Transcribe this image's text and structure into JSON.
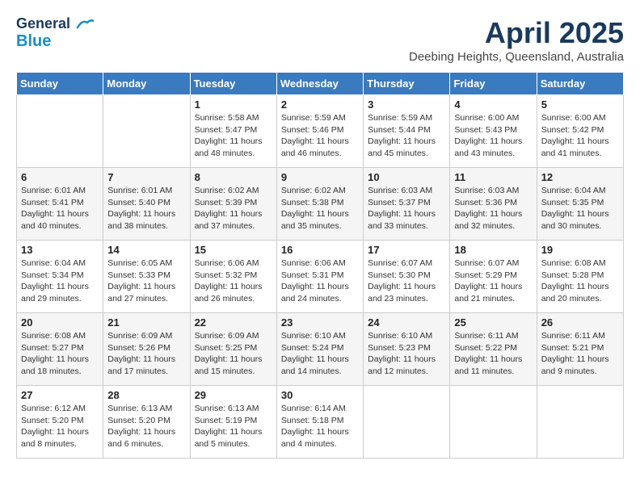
{
  "header": {
    "logo_line1": "General",
    "logo_line2": "Blue",
    "month": "April 2025",
    "location": "Deebing Heights, Queensland, Australia"
  },
  "weekdays": [
    "Sunday",
    "Monday",
    "Tuesday",
    "Wednesday",
    "Thursday",
    "Friday",
    "Saturday"
  ],
  "weeks": [
    [
      {
        "day": "",
        "info": ""
      },
      {
        "day": "",
        "info": ""
      },
      {
        "day": "1",
        "info": "Sunrise: 5:58 AM\nSunset: 5:47 PM\nDaylight: 11 hours and 48 minutes."
      },
      {
        "day": "2",
        "info": "Sunrise: 5:59 AM\nSunset: 5:46 PM\nDaylight: 11 hours and 46 minutes."
      },
      {
        "day": "3",
        "info": "Sunrise: 5:59 AM\nSunset: 5:44 PM\nDaylight: 11 hours and 45 minutes."
      },
      {
        "day": "4",
        "info": "Sunrise: 6:00 AM\nSunset: 5:43 PM\nDaylight: 11 hours and 43 minutes."
      },
      {
        "day": "5",
        "info": "Sunrise: 6:00 AM\nSunset: 5:42 PM\nDaylight: 11 hours and 41 minutes."
      }
    ],
    [
      {
        "day": "6",
        "info": "Sunrise: 6:01 AM\nSunset: 5:41 PM\nDaylight: 11 hours and 40 minutes."
      },
      {
        "day": "7",
        "info": "Sunrise: 6:01 AM\nSunset: 5:40 PM\nDaylight: 11 hours and 38 minutes."
      },
      {
        "day": "8",
        "info": "Sunrise: 6:02 AM\nSunset: 5:39 PM\nDaylight: 11 hours and 37 minutes."
      },
      {
        "day": "9",
        "info": "Sunrise: 6:02 AM\nSunset: 5:38 PM\nDaylight: 11 hours and 35 minutes."
      },
      {
        "day": "10",
        "info": "Sunrise: 6:03 AM\nSunset: 5:37 PM\nDaylight: 11 hours and 33 minutes."
      },
      {
        "day": "11",
        "info": "Sunrise: 6:03 AM\nSunset: 5:36 PM\nDaylight: 11 hours and 32 minutes."
      },
      {
        "day": "12",
        "info": "Sunrise: 6:04 AM\nSunset: 5:35 PM\nDaylight: 11 hours and 30 minutes."
      }
    ],
    [
      {
        "day": "13",
        "info": "Sunrise: 6:04 AM\nSunset: 5:34 PM\nDaylight: 11 hours and 29 minutes."
      },
      {
        "day": "14",
        "info": "Sunrise: 6:05 AM\nSunset: 5:33 PM\nDaylight: 11 hours and 27 minutes."
      },
      {
        "day": "15",
        "info": "Sunrise: 6:06 AM\nSunset: 5:32 PM\nDaylight: 11 hours and 26 minutes."
      },
      {
        "day": "16",
        "info": "Sunrise: 6:06 AM\nSunset: 5:31 PM\nDaylight: 11 hours and 24 minutes."
      },
      {
        "day": "17",
        "info": "Sunrise: 6:07 AM\nSunset: 5:30 PM\nDaylight: 11 hours and 23 minutes."
      },
      {
        "day": "18",
        "info": "Sunrise: 6:07 AM\nSunset: 5:29 PM\nDaylight: 11 hours and 21 minutes."
      },
      {
        "day": "19",
        "info": "Sunrise: 6:08 AM\nSunset: 5:28 PM\nDaylight: 11 hours and 20 minutes."
      }
    ],
    [
      {
        "day": "20",
        "info": "Sunrise: 6:08 AM\nSunset: 5:27 PM\nDaylight: 11 hours and 18 minutes."
      },
      {
        "day": "21",
        "info": "Sunrise: 6:09 AM\nSunset: 5:26 PM\nDaylight: 11 hours and 17 minutes."
      },
      {
        "day": "22",
        "info": "Sunrise: 6:09 AM\nSunset: 5:25 PM\nDaylight: 11 hours and 15 minutes."
      },
      {
        "day": "23",
        "info": "Sunrise: 6:10 AM\nSunset: 5:24 PM\nDaylight: 11 hours and 14 minutes."
      },
      {
        "day": "24",
        "info": "Sunrise: 6:10 AM\nSunset: 5:23 PM\nDaylight: 11 hours and 12 minutes."
      },
      {
        "day": "25",
        "info": "Sunrise: 6:11 AM\nSunset: 5:22 PM\nDaylight: 11 hours and 11 minutes."
      },
      {
        "day": "26",
        "info": "Sunrise: 6:11 AM\nSunset: 5:21 PM\nDaylight: 11 hours and 9 minutes."
      }
    ],
    [
      {
        "day": "27",
        "info": "Sunrise: 6:12 AM\nSunset: 5:20 PM\nDaylight: 11 hours and 8 minutes."
      },
      {
        "day": "28",
        "info": "Sunrise: 6:13 AM\nSunset: 5:20 PM\nDaylight: 11 hours and 6 minutes."
      },
      {
        "day": "29",
        "info": "Sunrise: 6:13 AM\nSunset: 5:19 PM\nDaylight: 11 hours and 5 minutes."
      },
      {
        "day": "30",
        "info": "Sunrise: 6:14 AM\nSunset: 5:18 PM\nDaylight: 11 hours and 4 minutes."
      },
      {
        "day": "",
        "info": ""
      },
      {
        "day": "",
        "info": ""
      },
      {
        "day": "",
        "info": ""
      }
    ]
  ]
}
